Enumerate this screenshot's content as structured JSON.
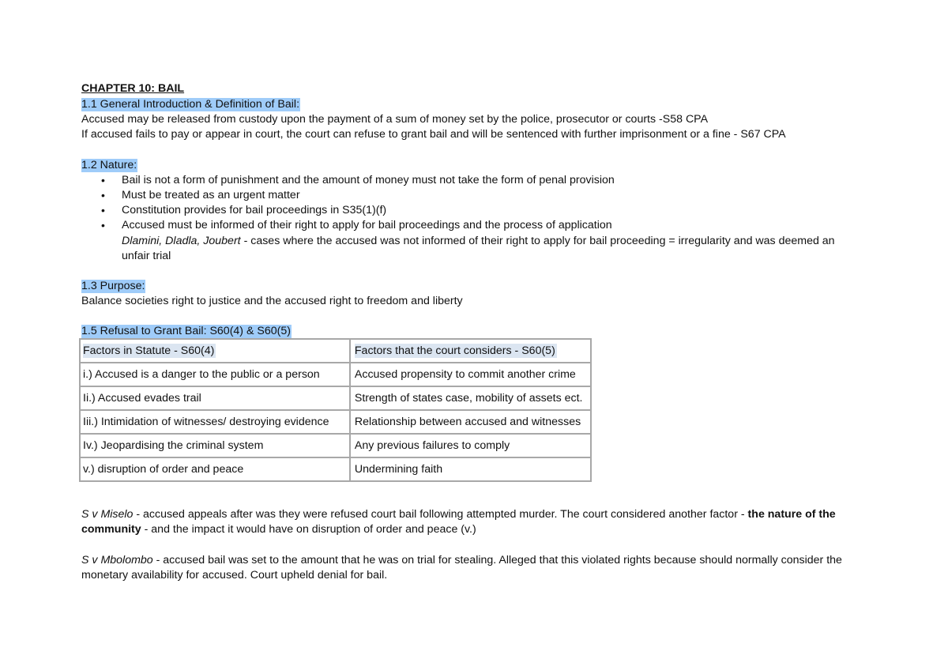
{
  "document": {
    "chapter_title": "CHAPTER 10: BAIL",
    "sections": {
      "intro": {
        "heading": "1.1 General Introduction & Definition of Bail:",
        "lines": [
          "Accused may be released from custody upon the payment of a sum of money set by the police, prosecutor or courts -S58 CPA",
          "If accused fails to pay or appear in court, the court can refuse to grant bail and will be sentenced with further imprisonment or a fine - S67 CPA"
        ]
      },
      "nature": {
        "heading": "1.2 Nature:",
        "bullet_glyph": "•",
        "bullets": [
          "Bail is not a form of punishment and the amount of money must not take the form of penal provision",
          "Must be treated as an urgent matter",
          "Constitution provides for bail proceedings in S35(1)(f)",
          "Accused must be informed of their right to apply for bail proceedings and the process of application"
        ],
        "case_note": {
          "cases": "Dlamini, Dladla, Joubert",
          "text_line1": " - cases where the accused was not informed of their right to apply for bail proceeding = irregularity and was deemed an",
          "text_line2": "unfair trial"
        }
      },
      "purpose": {
        "heading": "1.3 Purpose:",
        "text": "Balance societies right to justice and the accused right to freedom and liberty"
      },
      "refusal": {
        "heading": "1.5 Refusal to Grant Bail: S60(4) & S60(5)",
        "table": {
          "headers": [
            "Factors in Statute - S60(4)",
            "Factors that the court considers - S60(5)"
          ],
          "rows": [
            [
              "i.) Accused is a danger to the public or a person",
              "Accused propensity to commit another crime"
            ],
            [
              "Ii.) Accused evades trail",
              "Strength of states case, mobility of assets ect."
            ],
            [
              "Iii.) Intimidation of witnesses/ destroying evidence",
              "Relationship between accused and witnesses"
            ],
            [
              "Iv.) Jeopardising the criminal system",
              "Any previous failures to comply"
            ],
            [
              "v.) disruption of order and peace",
              "Undermining faith"
            ]
          ]
        }
      },
      "cases": {
        "miselo": {
          "name": " S v Miselo",
          "text1": " - accused appeals after was they were refused court bail following attempted murder. The court considered another factor - ",
          "bold1": "the nature of the",
          "bold2": "community",
          "text2": " - and the impact it would have on disruption of order and peace (v.)"
        },
        "mbolombo": {
          "name": "S v Mbolombo",
          "text1": " - accused bail was set to the amount that he was on trial for stealing. Alleged that this violated rights because should normally consider the",
          "text2": "monetary availability for accused. Court upheld denial for bail."
        }
      }
    },
    "colors": {
      "heading_highlight": "#9fccf9",
      "table_header_highlight": "#dbe5f1",
      "table_border": "#a8a8a8"
    }
  }
}
